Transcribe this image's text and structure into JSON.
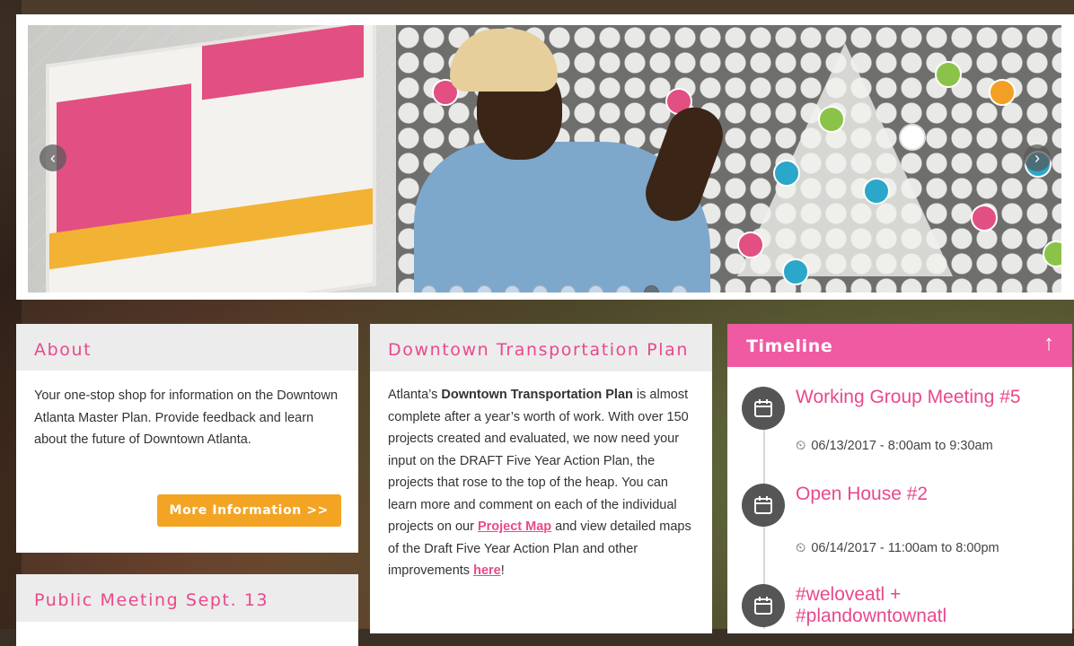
{
  "carousel": {
    "prev_label": "‹",
    "next_label": "›",
    "slide_count": 10,
    "active_slide": 9
  },
  "about": {
    "title": "About",
    "body": "Your one-stop shop for information on the Downtown Atlanta Master Plan. Provide feedback and learn about the future of Downtown Atlanta.",
    "button_label": "More Information >>"
  },
  "public_meeting": {
    "title": "Public Meeting Sept. 13"
  },
  "transportation": {
    "title": "Downtown Transportation Plan",
    "body_intro": "Atlanta’s ",
    "body_strong": "Downtown Transportation Plan",
    "body_mid": " is almost complete after a year’s worth of work. With over 150 projects created and evaluated, we now need your input on the DRAFT Five Year Action Plan, the projects that rose to the top of the heap. You can learn more and comment on each of the individual projects on our ",
    "link_project_map": "Project Map",
    "body_after_link": " and view detailed maps of the Draft Five Year Action Plan and other improvements ",
    "link_here": "here",
    "body_end": "!"
  },
  "timeline": {
    "title": "Timeline",
    "up_icon": "↑",
    "events": [
      {
        "title": "Working Group Meeting #5",
        "time": "06/13/2017 - 8:00am to 9:30am"
      },
      {
        "title": "Open House #2",
        "time": "06/14/2017 - 11:00am to 8:00pm"
      },
      {
        "title": "#weloveatl + #plandowntownatl",
        "time": ""
      }
    ]
  },
  "colors": {
    "accent_pink": "#e8498c",
    "timeline_pink": "#ef5aa2",
    "button_orange": "#f4a423"
  }
}
